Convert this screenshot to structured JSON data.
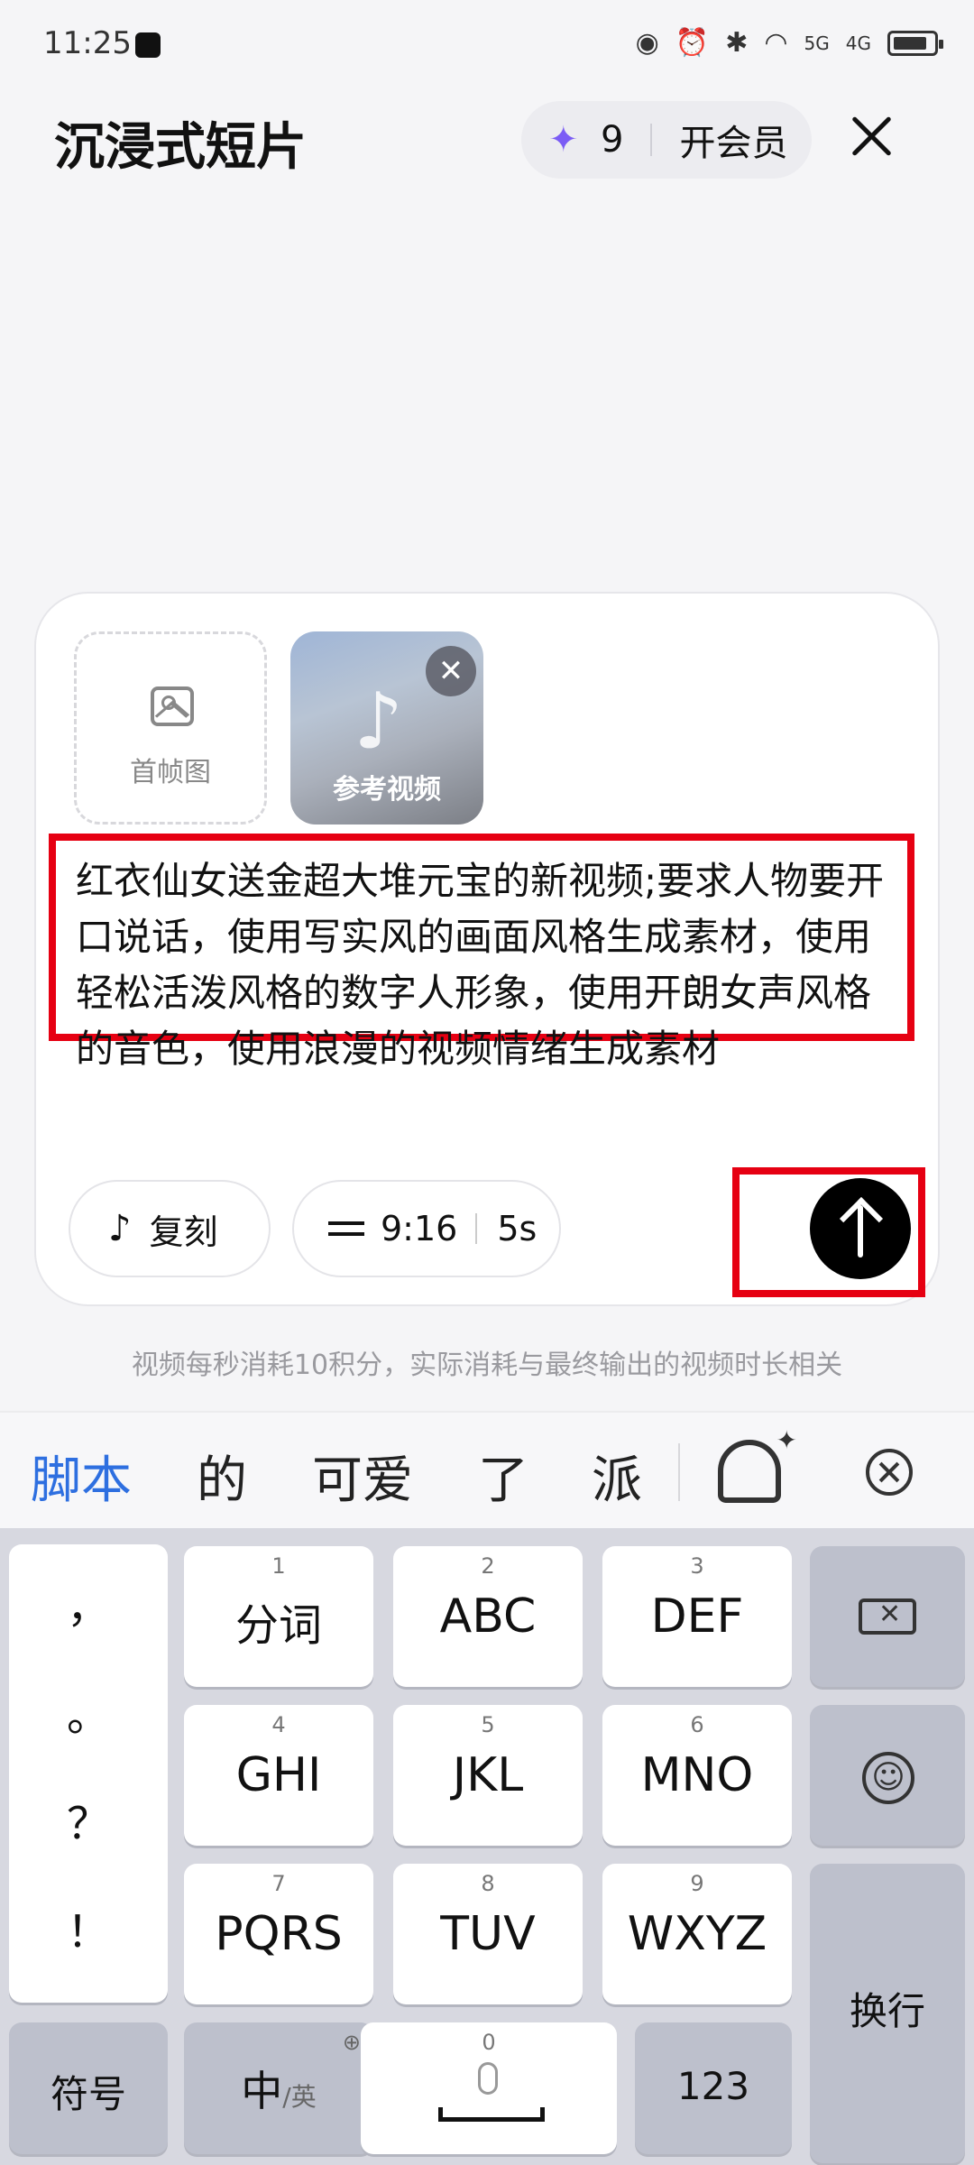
{
  "status": {
    "time": "11:25",
    "signal1": "5G",
    "signal2": "4G"
  },
  "header": {
    "title": "沉浸式短片",
    "credits": "9",
    "vip": "开会员"
  },
  "composer": {
    "first_frame_label": "首帧图",
    "ref_video_label": "参考视频",
    "prompt": "红衣仙女送金超大堆元宝的新视频;要求人物要开口说话，使用写实风的画面风格生成素材，使用轻松活泼风格的数字人形象，使用开朗女声风格的音色，使用浪漫的视频情绪生成素材",
    "copy_label": "复刻",
    "ratio": "9:16",
    "duration": "5s"
  },
  "hint": "视频每秒消耗10积分，实际消耗与最终输出的视频时长相关",
  "suggestions": [
    "脚本",
    "的",
    "可爱",
    "了",
    "派"
  ],
  "keyboard": {
    "punct": [
      "，",
      "。",
      "？",
      "！"
    ],
    "row1": [
      {
        "num": "1",
        "label": "分词"
      },
      {
        "num": "2",
        "label": "ABC"
      },
      {
        "num": "3",
        "label": "DEF"
      }
    ],
    "row2": [
      {
        "num": "4",
        "label": "GHI"
      },
      {
        "num": "5",
        "label": "JKL"
      },
      {
        "num": "6",
        "label": "MNO"
      }
    ],
    "row3": [
      {
        "num": "7",
        "label": "PQRS"
      },
      {
        "num": "8",
        "label": "TUV"
      },
      {
        "num": "9",
        "label": "WXYZ"
      }
    ],
    "symbols": "符号",
    "lang_main": "中",
    "lang_alt": "/英",
    "space_num": "0",
    "numbers": "123",
    "enter": "换行"
  },
  "colors": {
    "accent_blue": "#2e6fe0",
    "highlight_red": "#e60012",
    "star_purple": "#7b5cf5"
  }
}
